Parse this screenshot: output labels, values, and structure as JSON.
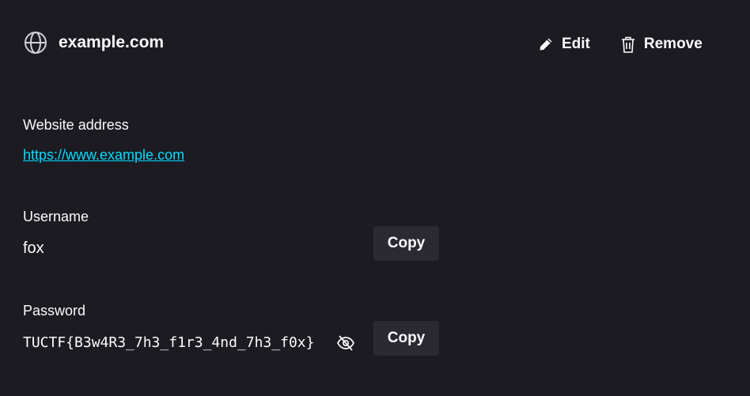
{
  "header": {
    "site_icon": "globe-icon",
    "title": "example.com",
    "edit_label": "Edit",
    "edit_icon": "pencil-icon",
    "remove_label": "Remove",
    "remove_icon": "trash-icon"
  },
  "website": {
    "label": "Website address",
    "url": "https://www.example.com"
  },
  "username": {
    "label": "Username",
    "value": "fox",
    "copy_label": "Copy"
  },
  "password": {
    "label": "Password",
    "value": "TUCTF{B3w4R3_7h3_f1r3_4nd_7h3_f0x}",
    "reveal_icon": "eye-slash-icon",
    "copy_label": "Copy"
  },
  "colors": {
    "background": "#1c1b22",
    "button_bg": "#2b2a33",
    "link": "#00ddff",
    "text": "#fbfbfe"
  }
}
